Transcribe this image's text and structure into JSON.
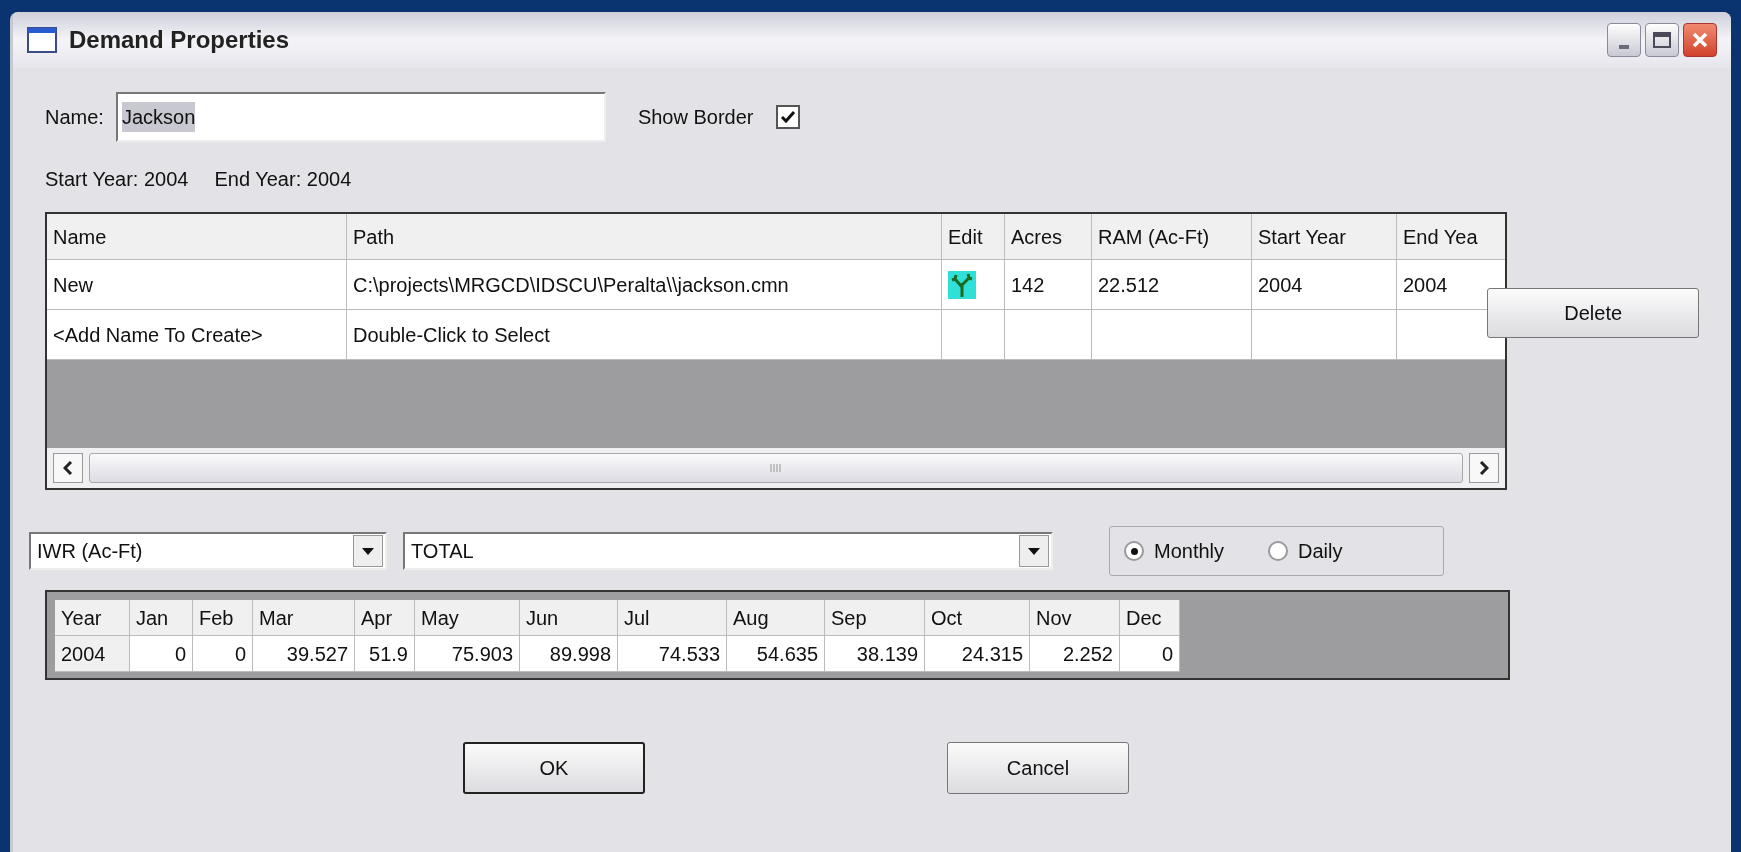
{
  "window": {
    "title": "Demand Properties"
  },
  "name_field": {
    "label": "Name:",
    "value": "Jackson"
  },
  "show_border": {
    "label": "Show Border",
    "checked": true
  },
  "years": [
    "Start Year: 2004",
    "End Year: 2004"
  ],
  "grid": {
    "columns": [
      "Name",
      "Path",
      "Edit",
      "Acres",
      "RAM (Ac-Ft)",
      "Start Year",
      "End Yea"
    ],
    "rows": [
      {
        "cells": [
          "New",
          "C:\\projects\\MRGCD\\IDSCU\\Peralta\\\\jackson.cmn",
          "",
          "142",
          "22.512",
          "2004",
          "2004"
        ],
        "edit_icon": true
      },
      {
        "cells": [
          "<Add Name To Create>",
          "Double-Click to Select",
          "",
          "",
          "",
          "",
          ""
        ],
        "edit_icon": false
      }
    ]
  },
  "delete_button": "Delete",
  "dropdowns": [
    "IWR (Ac-Ft)",
    "TOTAL"
  ],
  "period": [
    {
      "label": "Monthly",
      "selected": true
    },
    {
      "label": "Daily",
      "selected": false
    }
  ],
  "table": {
    "columns": [
      "Year",
      "Jan",
      "Feb",
      "Mar",
      "Apr",
      "May",
      "Jun",
      "Jul",
      "Aug",
      "Sep",
      "Oct",
      "Nov",
      "Dec"
    ],
    "rows": [
      [
        "2004",
        "0",
        "0",
        "39.527",
        "51.9",
        "75.903",
        "89.998",
        "74.533",
        "54.635",
        "38.139",
        "24.315",
        "2.252",
        "0"
      ]
    ]
  },
  "buttons": [
    "OK",
    "Cancel"
  ]
}
